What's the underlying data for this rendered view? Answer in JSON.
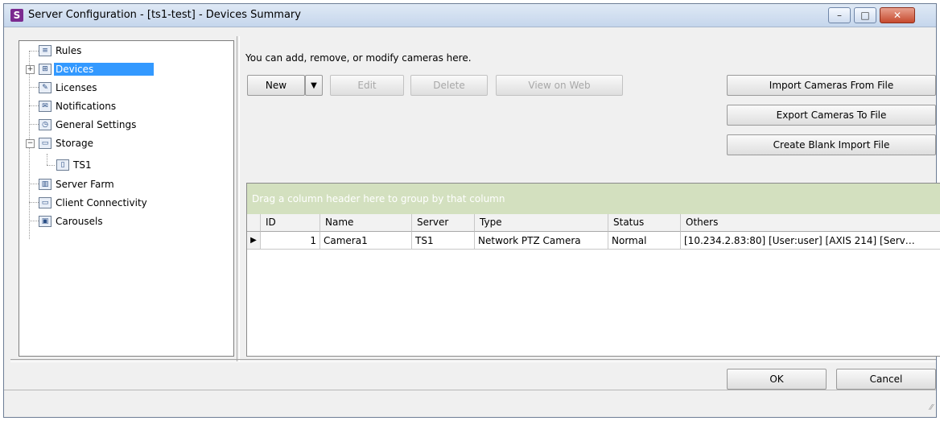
{
  "window": {
    "title": "Server Configuration - [ts1-test] - Devices Summary",
    "app_icon_letter": "S",
    "controls": {
      "minimize": "–",
      "maximize": "□",
      "close": "✕"
    }
  },
  "tree": {
    "items": [
      {
        "label": "Rules",
        "icon": "rules-icon"
      },
      {
        "label": "Devices",
        "icon": "devices-icon",
        "selected": true,
        "expander": "+"
      },
      {
        "label": "Licenses",
        "icon": "licenses-icon"
      },
      {
        "label": "Notifications",
        "icon": "notifications-icon"
      },
      {
        "label": "General Settings",
        "icon": "general-settings-icon"
      },
      {
        "label": "Storage",
        "icon": "storage-icon",
        "expander": "−"
      },
      {
        "label": "TS1",
        "icon": "server-icon"
      },
      {
        "label": "Server Farm",
        "icon": "server-farm-icon"
      },
      {
        "label": "Client Connectivity",
        "icon": "client-connectivity-icon"
      },
      {
        "label": "Carousels",
        "icon": "carousels-icon"
      }
    ]
  },
  "main": {
    "description": "You can add, remove, or modify cameras here.",
    "toolbar": {
      "new_label": "New",
      "dropdown_glyph": "▼",
      "edit_label": "Edit",
      "delete_label": "Delete",
      "view_on_web_label": "View on Web"
    },
    "side_buttons": {
      "import_label": "Import Cameras From File",
      "export_label": "Export Cameras To File",
      "create_blank_label": "Create Blank Import File"
    }
  },
  "grid": {
    "group_hint": "Drag a column header here to group by that column",
    "columns": [
      "ID",
      "Name",
      "Server",
      "Type",
      "Status",
      "Others"
    ],
    "rows": [
      {
        "id": "1",
        "name": "Camera1",
        "server": "TS1",
        "type": "Network PTZ Camera",
        "status": "Normal",
        "others": "[10.234.2.83:80] [User:user] [AXIS 214] [Serv…"
      }
    ],
    "row_indicator": "▶"
  },
  "footer": {
    "ok_label": "OK",
    "cancel_label": "Cancel",
    "grip": "⁄⁄"
  },
  "colors": {
    "selection": "#3399ff",
    "group_band": "#d3e0bf",
    "titlebar": "#c5d6ec"
  }
}
